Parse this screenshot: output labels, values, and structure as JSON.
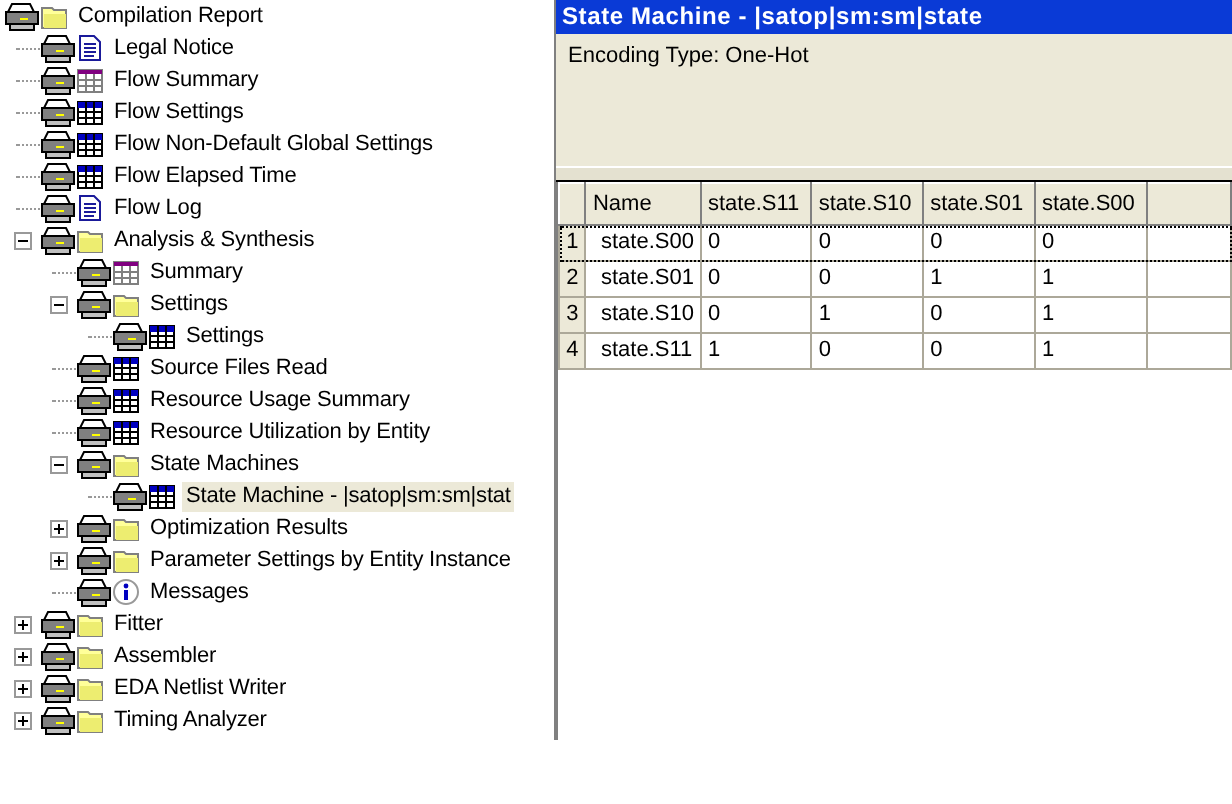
{
  "tree": [
    {
      "label": "Compilation Report",
      "kind": "folder",
      "selected": false,
      "children": [
        {
          "label": "Legal Notice",
          "kind": "document",
          "selected": false
        },
        {
          "label": "Flow Summary",
          "kind": "summary",
          "selected": false
        },
        {
          "label": "Flow Settings",
          "kind": "table",
          "selected": false
        },
        {
          "label": "Flow Non-Default Global Settings",
          "kind": "table",
          "selected": false
        },
        {
          "label": "Flow Elapsed Time",
          "kind": "table",
          "selected": false
        },
        {
          "label": "Flow Log",
          "kind": "document",
          "selected": false
        },
        {
          "label": "Analysis & Synthesis",
          "kind": "folder",
          "selected": false,
          "expanded": true,
          "children": [
            {
              "label": "Summary",
              "kind": "summary",
              "selected": false
            },
            {
              "label": "Settings",
              "kind": "folder",
              "selected": false,
              "expanded": true,
              "children": [
                {
                  "label": "Settings",
                  "kind": "table",
                  "selected": false
                }
              ]
            },
            {
              "label": "Source Files Read",
              "kind": "table",
              "selected": false
            },
            {
              "label": "Resource Usage Summary",
              "kind": "table",
              "selected": false
            },
            {
              "label": "Resource Utilization by Entity",
              "kind": "table",
              "selected": false
            },
            {
              "label": "State Machines",
              "kind": "folder",
              "selected": false,
              "expanded": true,
              "children": [
                {
                  "label": "State Machine - |satop|sm:sm|stat",
                  "kind": "table",
                  "selected": true
                }
              ]
            },
            {
              "label": "Optimization Results",
              "kind": "folder",
              "selected": false,
              "expanded": false
            },
            {
              "label": "Parameter Settings by Entity Instance",
              "kind": "folder",
              "selected": false,
              "expanded": false
            },
            {
              "label": "Messages",
              "kind": "info",
              "selected": false
            }
          ]
        },
        {
          "label": "Fitter",
          "kind": "folder",
          "selected": false,
          "expanded": false
        },
        {
          "label": "Assembler",
          "kind": "folder",
          "selected": false,
          "expanded": false
        },
        {
          "label": "EDA Netlist Writer",
          "kind": "folder",
          "selected": false,
          "expanded": false
        },
        {
          "label": "Timing Analyzer",
          "kind": "folder",
          "selected": false,
          "expanded": false
        }
      ]
    }
  ],
  "panel": {
    "title": "State Machine - |satop|sm:sm|state",
    "encoding": "Encoding Type:  One-Hot"
  },
  "table": {
    "columns": [
      "Name",
      "state.S11",
      "state.S10",
      "state.S01",
      "state.S00"
    ],
    "rows": [
      {
        "number": "1",
        "selected": true,
        "cells": [
          "state.S00",
          "0",
          "0",
          "0",
          "0"
        ]
      },
      {
        "number": "2",
        "selected": false,
        "cells": [
          "state.S01",
          "0",
          "0",
          "1",
          "1"
        ]
      },
      {
        "number": "3",
        "selected": false,
        "cells": [
          "state.S10",
          "0",
          "1",
          "0",
          "1"
        ]
      },
      {
        "number": "4",
        "selected": false,
        "cells": [
          "state.S11",
          "1",
          "0",
          "0",
          "1"
        ]
      }
    ]
  }
}
